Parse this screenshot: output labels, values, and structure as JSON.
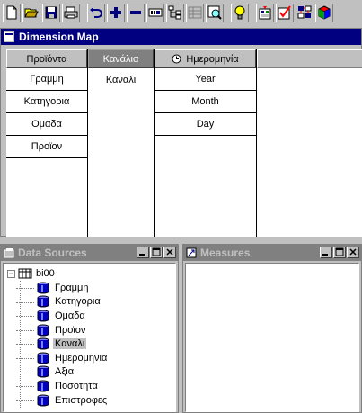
{
  "toolbar": {
    "buttons": [
      "new-icon",
      "open-icon",
      "save-icon",
      "print-icon",
      "undo-icon",
      "add-icon",
      "remove-icon",
      "rename-icon",
      "tree-icon",
      "grid-icon",
      "find-icon",
      "hint-icon",
      "publish-icon",
      "check-icon",
      "layout-icon",
      "cube-icon"
    ]
  },
  "dimension_map": {
    "title": "Dimension Map",
    "columns": [
      {
        "header": "Προϊόντα",
        "items": [
          "Γραμμη",
          "Κατηγορια",
          "Ομαδα",
          "Προϊον"
        ],
        "selected": false
      },
      {
        "header": "Κανάλια",
        "items": [
          "Καναλι"
        ],
        "selected": true
      },
      {
        "header": "Ημερομηνία",
        "items": [
          "Year",
          "Month",
          "Day"
        ],
        "selected": false
      }
    ]
  },
  "data_sources": {
    "title": "Data Sources",
    "root": "bi00",
    "items": [
      "Γραμμη",
      "Κατηγορια",
      "Ομαδα",
      "Προϊον",
      "Καναλι",
      "Ημερομηνια",
      "Αξια",
      "Ποσοτητα",
      "Επιστροφες"
    ],
    "selected_item": "Καναλι"
  },
  "measures": {
    "title": "Measures"
  },
  "colors": {
    "title_active": "#000080",
    "title_inactive": "#808080",
    "face": "#c0c0c0"
  }
}
